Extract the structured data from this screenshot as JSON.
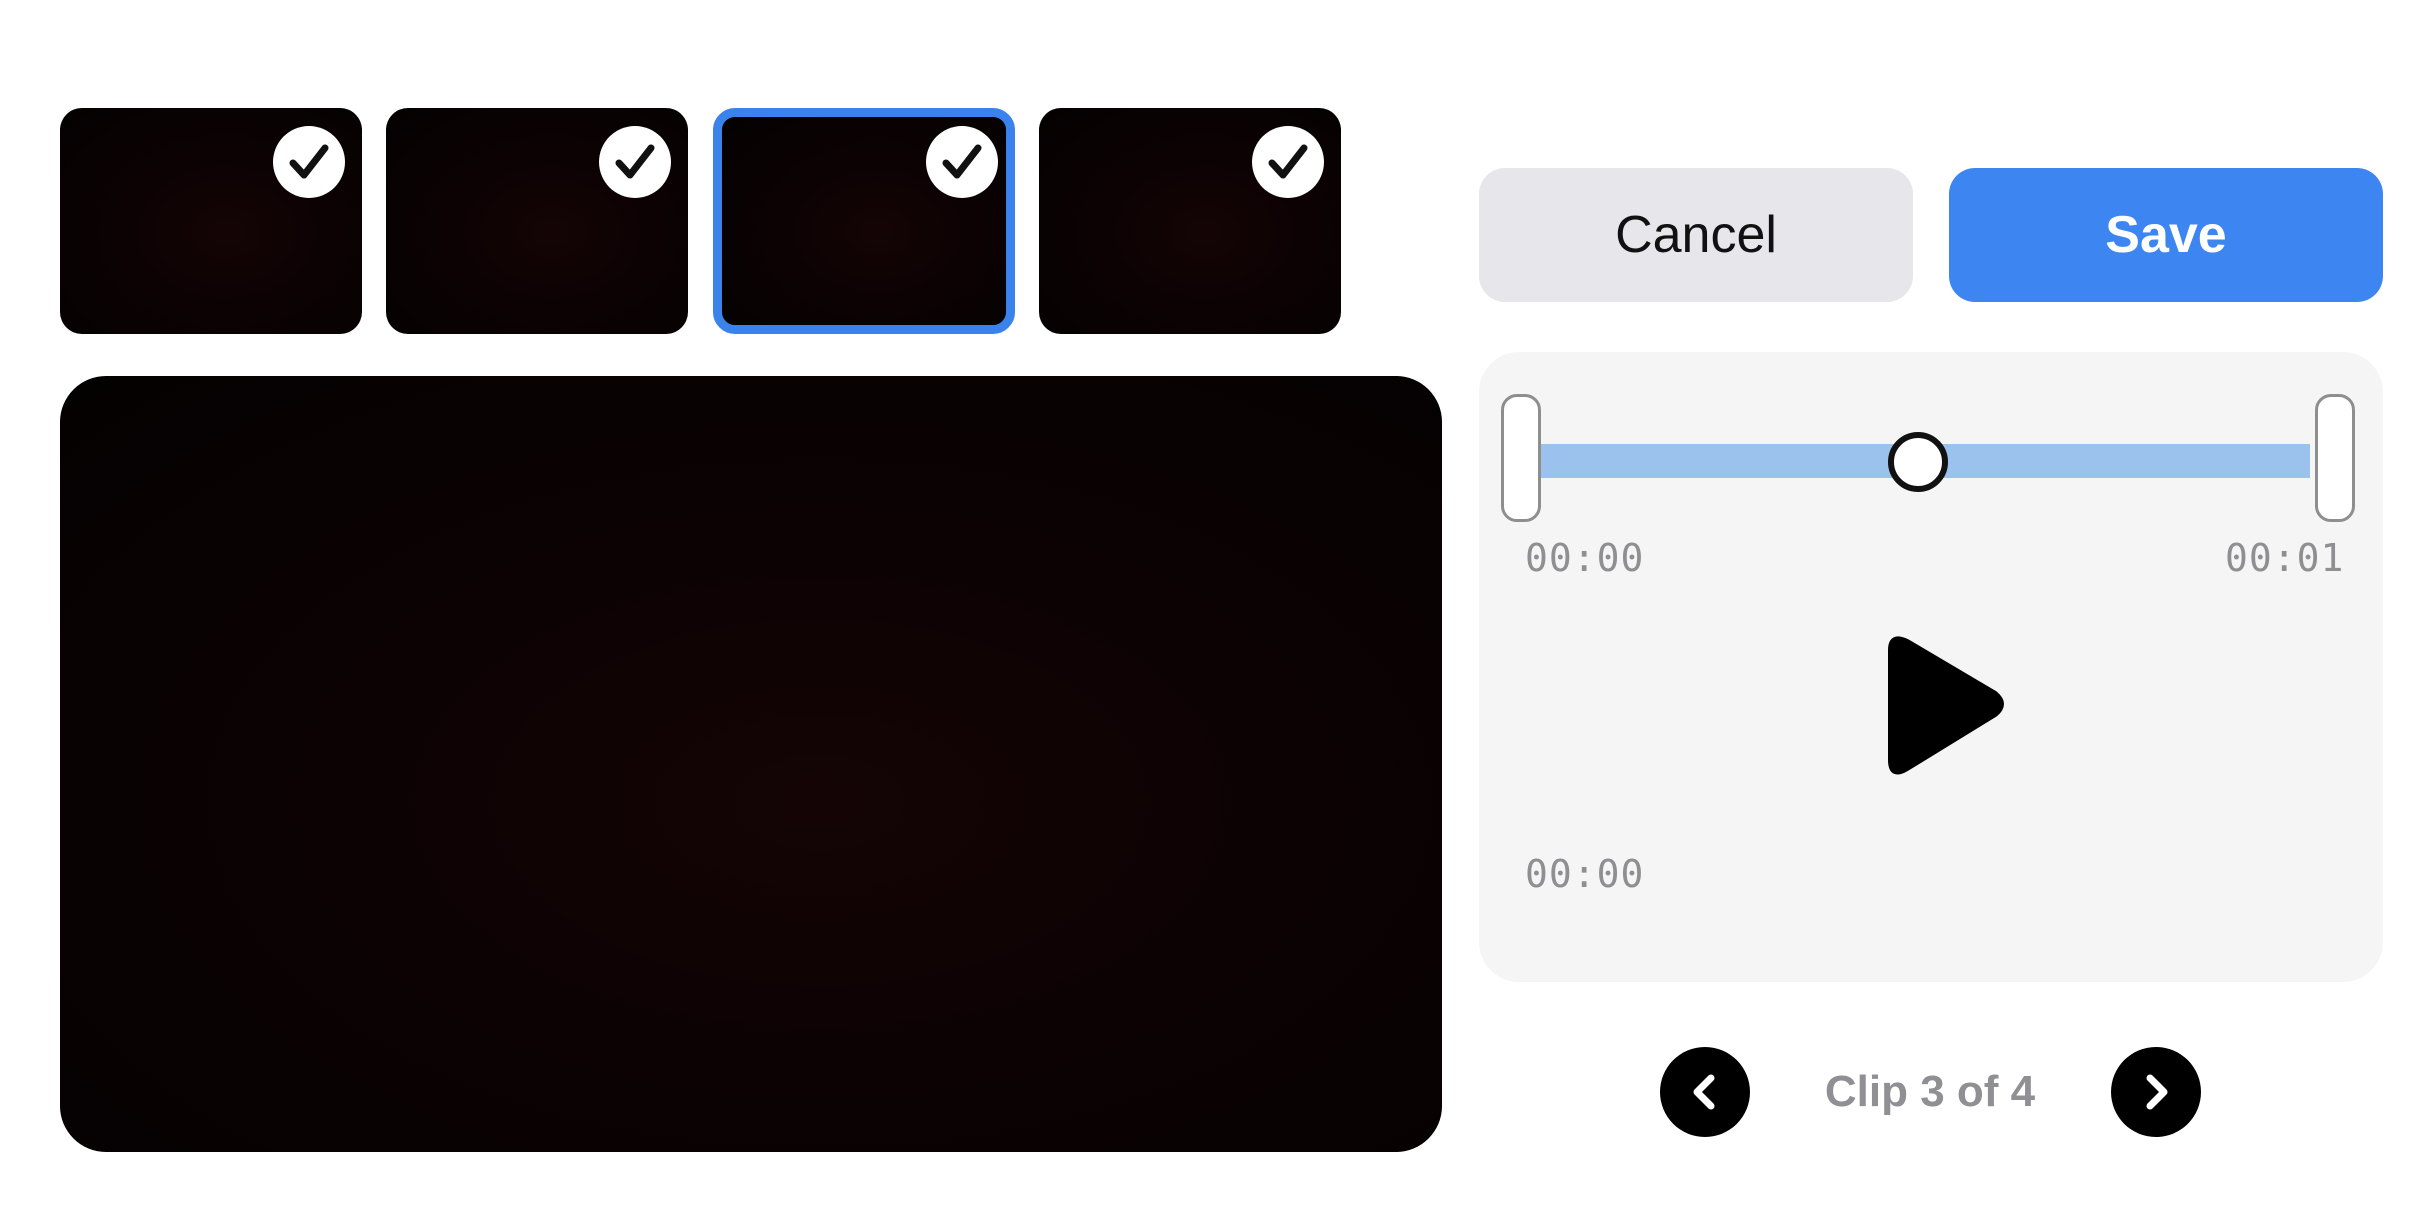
{
  "thumbnails": [
    {
      "checked": true,
      "selected": false,
      "icon": "checkmark-icon"
    },
    {
      "checked": true,
      "selected": false,
      "icon": "checkmark-icon"
    },
    {
      "checked": true,
      "selected": true,
      "icon": "checkmark-icon"
    },
    {
      "checked": true,
      "selected": false,
      "icon": "checkmark-icon"
    }
  ],
  "actions": {
    "cancel_label": "Cancel",
    "save_label": "Save"
  },
  "trimmer": {
    "start_time": "00:00",
    "end_time": "00:01",
    "playhead_fraction": 0.5
  },
  "player": {
    "current_time": "00:00",
    "play_icon": "play-icon"
  },
  "clip_nav": {
    "label": "Clip 3 of 4",
    "prev_icon": "chevron-left-icon",
    "next_icon": "chevron-right-icon"
  },
  "colors": {
    "accent": "#3d86f2",
    "selected_border": "#3a83ec",
    "trim_track": "#9bc1ed",
    "panel_bg": "#f5f5f6",
    "cancel_bg": "#e6e6eb"
  }
}
